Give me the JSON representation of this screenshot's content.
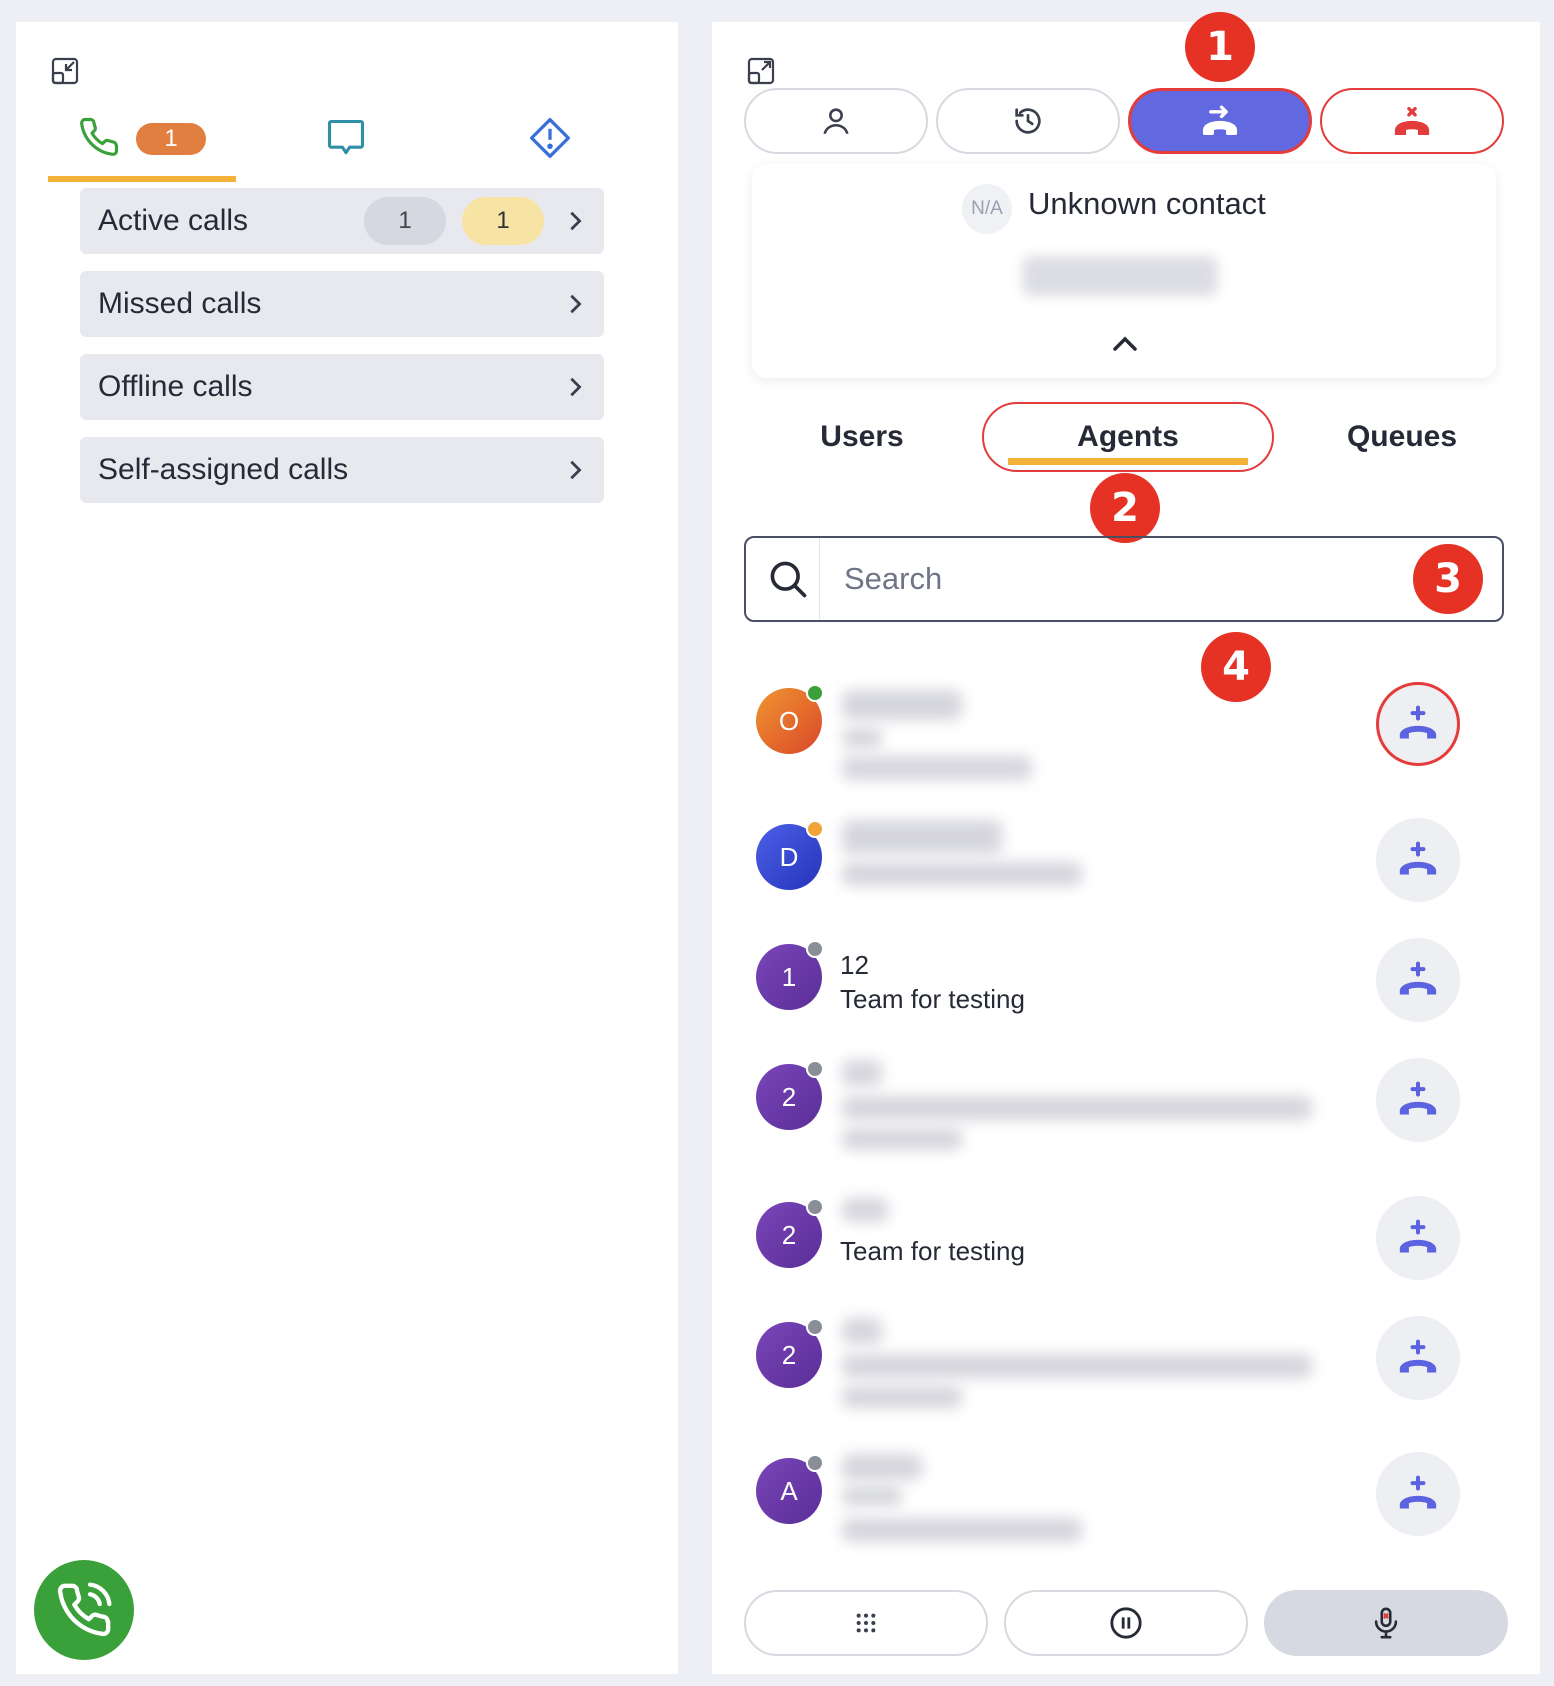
{
  "left": {
    "tabs": {
      "calls_badge": "1"
    },
    "call_list": [
      {
        "label": "Active calls",
        "count_grey": "1",
        "count_yellow": "1"
      },
      {
        "label": "Missed calls"
      },
      {
        "label": "Offline calls"
      },
      {
        "label": "Self-assigned calls"
      }
    ]
  },
  "right": {
    "contact": {
      "avatar_text": "N/A",
      "name": "Unknown contact"
    },
    "list_tabs": [
      "Users",
      "Agents",
      "Queues"
    ],
    "active_tab": "Agents",
    "search": {
      "placeholder": "Search"
    },
    "agents": [
      {
        "initial": "O",
        "name": "",
        "team": "",
        "status": "active",
        "color": "#e0702d"
      },
      {
        "initial": "D",
        "name": "",
        "team": "",
        "status": "paused",
        "color": "#3b4ed8"
      },
      {
        "initial": "1",
        "name": "12",
        "team": "Team for testing",
        "status": "offline",
        "color": "#6a3aa6"
      },
      {
        "initial": "2",
        "name": "",
        "team": "",
        "status": "offline",
        "color": "#6a3aa6"
      },
      {
        "initial": "2",
        "name": "",
        "team": "Team for testing",
        "status": "offline",
        "color": "#6a3aa6"
      },
      {
        "initial": "2",
        "name": "",
        "team": "",
        "status": "offline",
        "color": "#6a3aa6"
      },
      {
        "initial": "A",
        "name": "",
        "team": "",
        "status": "offline",
        "color": "#6a3aa6"
      }
    ]
  },
  "markers": [
    "1",
    "2",
    "3",
    "4"
  ],
  "colors": {
    "accent": "#6168e0",
    "underline": "#f2b237",
    "marker": "#e53224",
    "call_green": "#3aa03a",
    "danger": "#e43b3b"
  }
}
